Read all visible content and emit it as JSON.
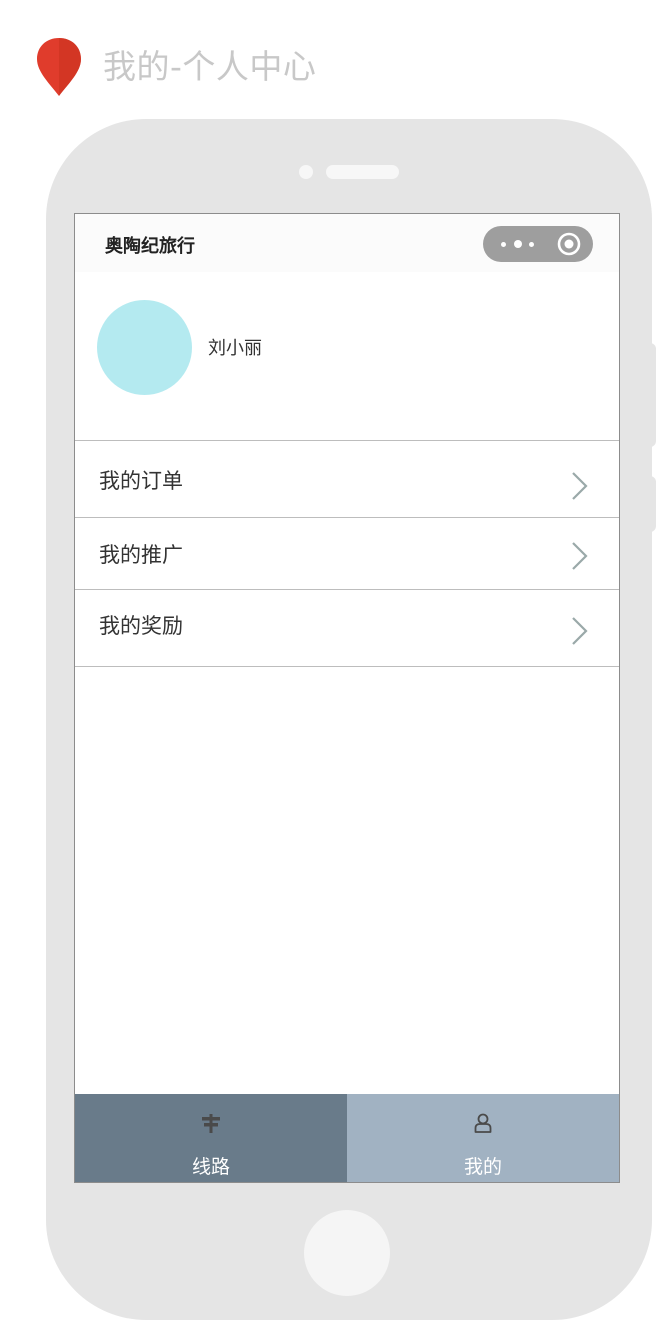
{
  "annotation": {
    "title": "我的-个人中心",
    "pin_color": "#e03c2c"
  },
  "navbar": {
    "title": "奥陶纪旅行",
    "capsule_more_icon": "more-dots-icon",
    "capsule_close_icon": "target-circle-icon"
  },
  "profile": {
    "username": "刘小丽",
    "avatar_color": "#b4eaf0"
  },
  "menu": {
    "items": [
      {
        "label": "我的订单",
        "icon": "chevron-right-icon"
      },
      {
        "label": "我的推广",
        "icon": "chevron-right-icon"
      },
      {
        "label": "我的奖励",
        "icon": "chevron-right-icon"
      }
    ]
  },
  "tabbar": {
    "tabs": [
      {
        "label": "线路",
        "icon": "signpost-icon",
        "active": true,
        "color": "#697b8a"
      },
      {
        "label": "我的",
        "icon": "user-icon",
        "active": false,
        "color": "#a1b2c2"
      }
    ]
  }
}
